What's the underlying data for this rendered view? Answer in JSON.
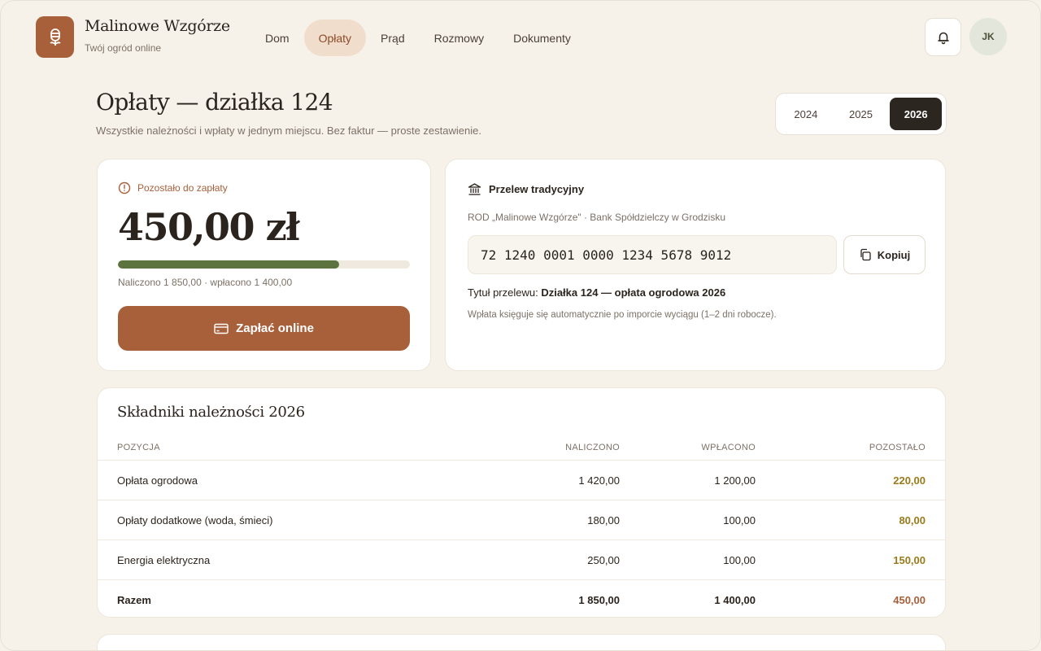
{
  "brand": {
    "name": "Malinowe Wzgórze",
    "tagline": "Twój ogród online",
    "logo_icon": "flower-icon"
  },
  "nav": {
    "items": [
      {
        "label": "Dom",
        "active": false
      },
      {
        "label": "Opłaty",
        "active": true
      },
      {
        "label": "Prąd",
        "active": false
      },
      {
        "label": "Rozmowy",
        "active": false
      },
      {
        "label": "Dokumenty",
        "active": false
      }
    ]
  },
  "user": {
    "initials": "JK"
  },
  "page": {
    "title": "Opłaty — działka 124",
    "subtitle": "Wszystkie należności i wpłaty w jednym miejscu. Bez faktur — proste zestawienie."
  },
  "years": {
    "options": [
      "2024",
      "2025",
      "2026"
    ],
    "selected": "2026"
  },
  "due": {
    "label": "Pozostało do zapłaty",
    "amount": "450,00 zł",
    "progress_fraction": 0.757,
    "meta": "Naliczono 1 850,00 · wpłacono 1 400,00",
    "pay_label": "Zapłać online"
  },
  "transfer": {
    "heading": "Przelew tradycyjny",
    "bank": "ROD „Malinowe Wzgórze\" · Bank Spółdzielczy w Grodzisku",
    "iban": "72 1240 0001 0000 1234 5678 9012",
    "copy_label": "Kopiuj",
    "title_prefix": "Tytuł przelewu:",
    "title_value": "Działka 124 — opłata ogrodowa 2026",
    "note": "Wpłata księguje się automatycznie po imporcie wyciągu (1–2 dni robocze)."
  },
  "table": {
    "title": "Składniki należności 2026",
    "headers": {
      "position": "POZYCJA",
      "charged": "NALICZONO",
      "paid": "WPŁACONO",
      "remaining": "POZOSTAŁO"
    },
    "rows": [
      {
        "name": "Opłata ogrodowa",
        "charged": "1 420,00",
        "paid": "1 200,00",
        "remaining": "220,00"
      },
      {
        "name": "Opłaty dodatkowe (woda, śmieci)",
        "charged": "180,00",
        "paid": "100,00",
        "remaining": "80,00"
      },
      {
        "name": "Energia elektryczna",
        "charged": "250,00",
        "paid": "100,00",
        "remaining": "150,00"
      }
    ],
    "total": {
      "name": "Razem",
      "charged": "1 850,00",
      "paid": "1 400,00",
      "remaining": "450,00"
    }
  },
  "colors": {
    "accent": "#a8603b",
    "progress": "#5c7340",
    "remaining_text": "#9a7a1a",
    "background": "#f6f2ea"
  }
}
